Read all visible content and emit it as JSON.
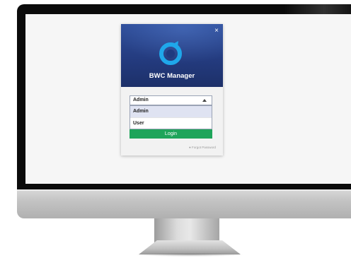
{
  "app": {
    "title": "BWC Manager"
  },
  "dialog": {
    "close_symbol": "×"
  },
  "login": {
    "role_selected": "Admin",
    "role_options": [
      "Admin",
      "User"
    ],
    "login_label": "Login",
    "forgot_password_label": "Forgot Password"
  },
  "colors": {
    "header_top": "#2f4e9a",
    "header_bottom": "#1d3069",
    "logo_accent": "#1fa7ea",
    "login_button": "#1ea45a"
  },
  "icons": {
    "logo": "bwc-logo-icon",
    "close": "close-icon",
    "dropdown": "chevron-up-icon"
  }
}
